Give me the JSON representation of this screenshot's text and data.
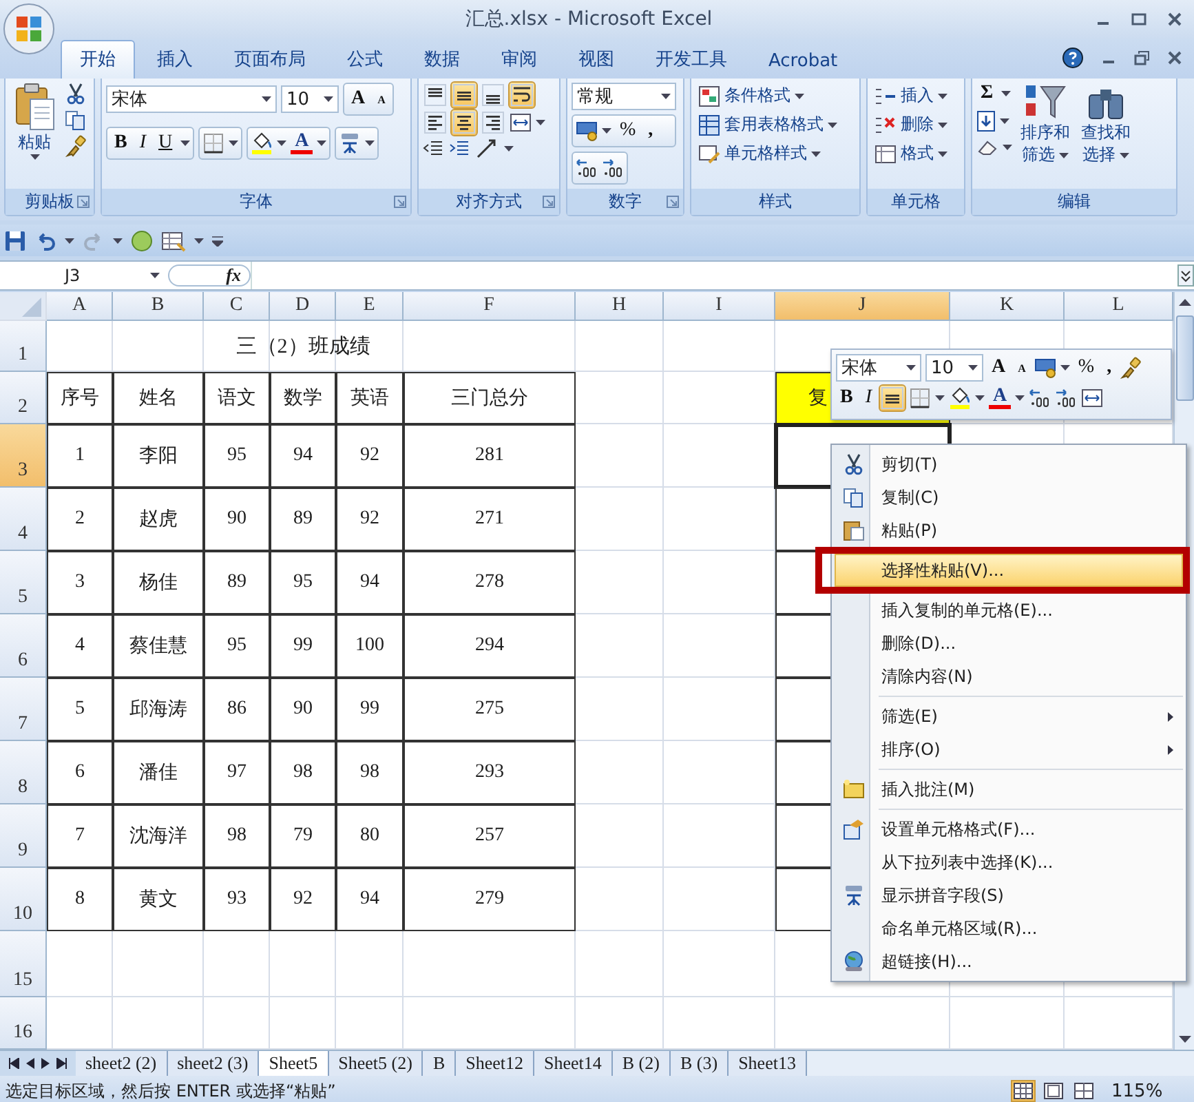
{
  "window": {
    "title": "汇总.xlsx - Microsoft Excel"
  },
  "tabs": [
    {
      "label": "开始",
      "selected": true
    },
    {
      "label": "插入",
      "selected": false
    },
    {
      "label": "页面布局",
      "selected": false
    },
    {
      "label": "公式",
      "selected": false
    },
    {
      "label": "数据",
      "selected": false
    },
    {
      "label": "审阅",
      "selected": false
    },
    {
      "label": "视图",
      "selected": false
    },
    {
      "label": "开发工具",
      "selected": false
    },
    {
      "label": "Acrobat",
      "selected": false
    }
  ],
  "ribbon": [
    {
      "kind": "clipboard",
      "title": "剪贴板",
      "launcher": true,
      "paste": "粘贴"
    },
    {
      "kind": "font",
      "title": "字体",
      "launcher": true,
      "font": "宋体",
      "size": "10",
      "grow": "A",
      "shrink": "A",
      "bold": "B",
      "italic": "I",
      "underline": "U",
      "font_color": "A"
    },
    {
      "kind": "alignment",
      "title": "对齐方式",
      "launcher": true,
      "vertical": [
        {
          "selected": false
        },
        {
          "selected": true
        },
        {
          "selected": false
        }
      ],
      "horizontal": [
        {
          "selected": false
        },
        {
          "selected": true
        },
        {
          "selected": false
        }
      ],
      "wrap_text": {
        "selected": true
      }
    },
    {
      "kind": "number",
      "title": "数字",
      "launcher": true,
      "format": "常规",
      "percent": "%",
      "comma": ","
    },
    {
      "kind": "styles",
      "title": "样式",
      "launcher": false,
      "items": [
        "条件格式",
        "套用表格格式",
        "单元格样式"
      ]
    },
    {
      "kind": "cells",
      "title": "单元格",
      "launcher": false,
      "items": [
        "插入",
        "删除",
        "格式"
      ]
    },
    {
      "kind": "editing",
      "title": "编辑",
      "launcher": false,
      "sum": "Σ",
      "buttons": [
        {
          "lines": [
            "排序和",
            "筛选"
          ]
        },
        {
          "lines": [
            "查找和",
            "选择"
          ]
        }
      ]
    }
  ],
  "formula_bar": {
    "name_box": "J3",
    "fx": "fx"
  },
  "sheet": {
    "columns": [
      {
        "label": "A",
        "selected": false
      },
      {
        "label": "B",
        "selected": false
      },
      {
        "label": "C",
        "selected": false
      },
      {
        "label": "D",
        "selected": false
      },
      {
        "label": "E",
        "selected": false
      },
      {
        "label": "F",
        "selected": false
      },
      {
        "label": "H",
        "selected": false
      },
      {
        "label": "I",
        "selected": false
      },
      {
        "label": "J",
        "selected": true
      },
      {
        "label": "K",
        "selected": false
      },
      {
        "label": "L",
        "selected": false
      }
    ],
    "rows": [
      {
        "header": "1",
        "selected": false,
        "cells": [
          {
            "text": "",
            "bordered": false
          },
          {
            "text": "",
            "bordered": false
          },
          {
            "text": "",
            "bordered": false
          },
          {
            "text": "三（2）班成绩",
            "bordered": false
          }
        ]
      },
      {
        "header": "2",
        "selected": false,
        "cells": [
          {
            "text": "序号",
            "bordered": true
          },
          {
            "text": "姓名",
            "bordered": true
          },
          {
            "text": "语文",
            "bordered": true
          },
          {
            "text": "数学",
            "bordered": true
          },
          {
            "text": "英语",
            "bordered": true
          },
          {
            "text": "三门总分",
            "bordered": true
          },
          {
            "text": "",
            "bordered": false
          },
          {
            "text": "",
            "bordered": false
          },
          {
            "text": "复",
            "bordered": true,
            "color": "#ffff00"
          }
        ]
      },
      {
        "header": "3",
        "selected": true,
        "cells": [
          {
            "text": "1",
            "bordered": true
          },
          {
            "text": "李阳",
            "bordered": true
          },
          {
            "text": "95",
            "bordered": true
          },
          {
            "text": "94",
            "bordered": true
          },
          {
            "text": "92",
            "bordered": true
          },
          {
            "text": "281",
            "bordered": true
          },
          {
            "text": "",
            "bordered": false
          },
          {
            "text": "",
            "bordered": false
          },
          {
            "text": "",
            "bordered": true
          }
        ]
      },
      {
        "header": "4",
        "selected": false,
        "cells": [
          {
            "text": "2",
            "bordered": true
          },
          {
            "text": "赵虎",
            "bordered": true
          },
          {
            "text": "90",
            "bordered": true
          },
          {
            "text": "89",
            "bordered": true
          },
          {
            "text": "92",
            "bordered": true
          },
          {
            "text": "271",
            "bordered": true
          },
          {
            "text": "",
            "bordered": false
          },
          {
            "text": "",
            "bordered": false
          },
          {
            "text": "",
            "bordered": true
          }
        ]
      },
      {
        "header": "5",
        "selected": false,
        "cells": [
          {
            "text": "3",
            "bordered": true
          },
          {
            "text": "杨佳",
            "bordered": true
          },
          {
            "text": "89",
            "bordered": true
          },
          {
            "text": "95",
            "bordered": true
          },
          {
            "text": "94",
            "bordered": true
          },
          {
            "text": "278",
            "bordered": true
          },
          {
            "text": "",
            "bordered": false
          },
          {
            "text": "",
            "bordered": false
          },
          {
            "text": "",
            "bordered": true
          }
        ]
      },
      {
        "header": "6",
        "selected": false,
        "cells": [
          {
            "text": "4",
            "bordered": true
          },
          {
            "text": "蔡佳慧",
            "bordered": true
          },
          {
            "text": "95",
            "bordered": true
          },
          {
            "text": "99",
            "bordered": true
          },
          {
            "text": "100",
            "bordered": true
          },
          {
            "text": "294",
            "bordered": true
          },
          {
            "text": "",
            "bordered": false
          },
          {
            "text": "",
            "bordered": false
          },
          {
            "text": "",
            "bordered": true
          }
        ]
      },
      {
        "header": "7",
        "selected": false,
        "cells": [
          {
            "text": "5",
            "bordered": true
          },
          {
            "text": "邱海涛",
            "bordered": true
          },
          {
            "text": "86",
            "bordered": true
          },
          {
            "text": "90",
            "bordered": true
          },
          {
            "text": "99",
            "bordered": true
          },
          {
            "text": "275",
            "bordered": true
          },
          {
            "text": "",
            "bordered": false
          },
          {
            "text": "",
            "bordered": false
          },
          {
            "text": "",
            "bordered": true
          }
        ]
      },
      {
        "header": "8",
        "selected": false,
        "cells": [
          {
            "text": "6",
            "bordered": true
          },
          {
            "text": "潘佳",
            "bordered": true
          },
          {
            "text": "97",
            "bordered": true
          },
          {
            "text": "98",
            "bordered": true
          },
          {
            "text": "98",
            "bordered": true
          },
          {
            "text": "293",
            "bordered": true
          },
          {
            "text": "",
            "bordered": false
          },
          {
            "text": "",
            "bordered": false
          },
          {
            "text": "",
            "bordered": true
          }
        ]
      },
      {
        "header": "9",
        "selected": false,
        "cells": [
          {
            "text": "7",
            "bordered": true
          },
          {
            "text": "沈海洋",
            "bordered": true
          },
          {
            "text": "98",
            "bordered": true
          },
          {
            "text": "79",
            "bordered": true
          },
          {
            "text": "80",
            "bordered": true
          },
          {
            "text": "257",
            "bordered": true
          },
          {
            "text": "",
            "bordered": false
          },
          {
            "text": "",
            "bordered": false
          },
          {
            "text": "",
            "bordered": true
          }
        ]
      },
      {
        "header": "10",
        "selected": false,
        "cells": [
          {
            "text": "8",
            "bordered": true
          },
          {
            "text": "黄文",
            "bordered": true
          },
          {
            "text": "93",
            "bordered": true
          },
          {
            "text": "92",
            "bordered": true
          },
          {
            "text": "94",
            "bordered": true
          },
          {
            "text": "279",
            "bordered": true
          },
          {
            "text": "",
            "bordered": false
          },
          {
            "text": "",
            "bordered": false
          },
          {
            "text": "",
            "bordered": true
          }
        ]
      },
      {
        "header": "15",
        "selected": false,
        "cells": []
      },
      {
        "header": "16",
        "selected": false,
        "cells": []
      }
    ]
  },
  "mini_toolbar": {
    "font": "宋体",
    "size": "10",
    "grow": "A",
    "shrink": "A",
    "percent": "%",
    "comma": ",",
    "bold": "B",
    "italic": "I",
    "center": {
      "selected": true
    },
    "font_color": "A"
  },
  "context_menu": [
    {
      "label": "剪切(T)",
      "kind": "cut",
      "selected": false,
      "submenu": false,
      "separator_before": false
    },
    {
      "label": "复制(C)",
      "kind": "copy",
      "selected": false,
      "submenu": false,
      "separator_before": false
    },
    {
      "label": "粘贴(P)",
      "kind": "paste",
      "selected": false,
      "submenu": false,
      "separator_before": false
    },
    {
      "label": "选择性粘贴(V)...",
      "kind": "plain",
      "selected": true,
      "submenu": false,
      "separator_before": false
    },
    {
      "label": "插入复制的单元格(E)...",
      "kind": "plain",
      "selected": false,
      "submenu": false,
      "separator_before": false
    },
    {
      "label": "删除(D)...",
      "kind": "plain",
      "selected": false,
      "submenu": false,
      "separator_before": false
    },
    {
      "label": "清除内容(N)",
      "kind": "plain",
      "selected": false,
      "submenu": false,
      "separator_before": false
    },
    {
      "label": "筛选(E)",
      "kind": "plain",
      "selected": false,
      "submenu": true,
      "separator_before": true
    },
    {
      "label": "排序(O)",
      "kind": "plain",
      "selected": false,
      "submenu": true,
      "separator_before": false
    },
    {
      "label": "插入批注(M)",
      "kind": "comment",
      "selected": false,
      "submenu": false,
      "separator_before": true
    },
    {
      "label": "设置单元格格式(F)...",
      "kind": "format",
      "selected": false,
      "submenu": false,
      "separator_before": true
    },
    {
      "label": "从下拉列表中选择(K)...",
      "kind": "plain",
      "selected": false,
      "submenu": false,
      "separator_before": false
    },
    {
      "label": "显示拼音字段(S)",
      "kind": "phonetic",
      "selected": false,
      "submenu": false,
      "separator_before": false
    },
    {
      "label": "命名单元格区域(R)...",
      "kind": "plain",
      "selected": false,
      "submenu": false,
      "separator_before": false
    },
    {
      "label": "超链接(H)...",
      "kind": "link",
      "selected": false,
      "submenu": false,
      "separator_before": false
    }
  ],
  "sheet_tabs": [
    {
      "label": "sheet2 (2)",
      "selected": false
    },
    {
      "label": "sheet2 (3)",
      "selected": false
    },
    {
      "label": "Sheet5",
      "selected": true
    },
    {
      "label": "Sheet5 (2)",
      "selected": false
    },
    {
      "label": "B",
      "selected": false
    },
    {
      "label": "Sheet12",
      "selected": false
    },
    {
      "label": "Sheet14",
      "selected": false
    },
    {
      "label": "B (2)",
      "selected": false
    },
    {
      "label": "B (3)",
      "selected": false
    },
    {
      "label": "Sheet13",
      "selected": false
    }
  ],
  "status_bar": {
    "message": "选定目标区域，然后按 ENTER 或选择“粘贴”",
    "views": [
      {
        "selected": true
      },
      {
        "selected": false
      },
      {
        "selected": false
      }
    ],
    "zoom": "115%"
  }
}
